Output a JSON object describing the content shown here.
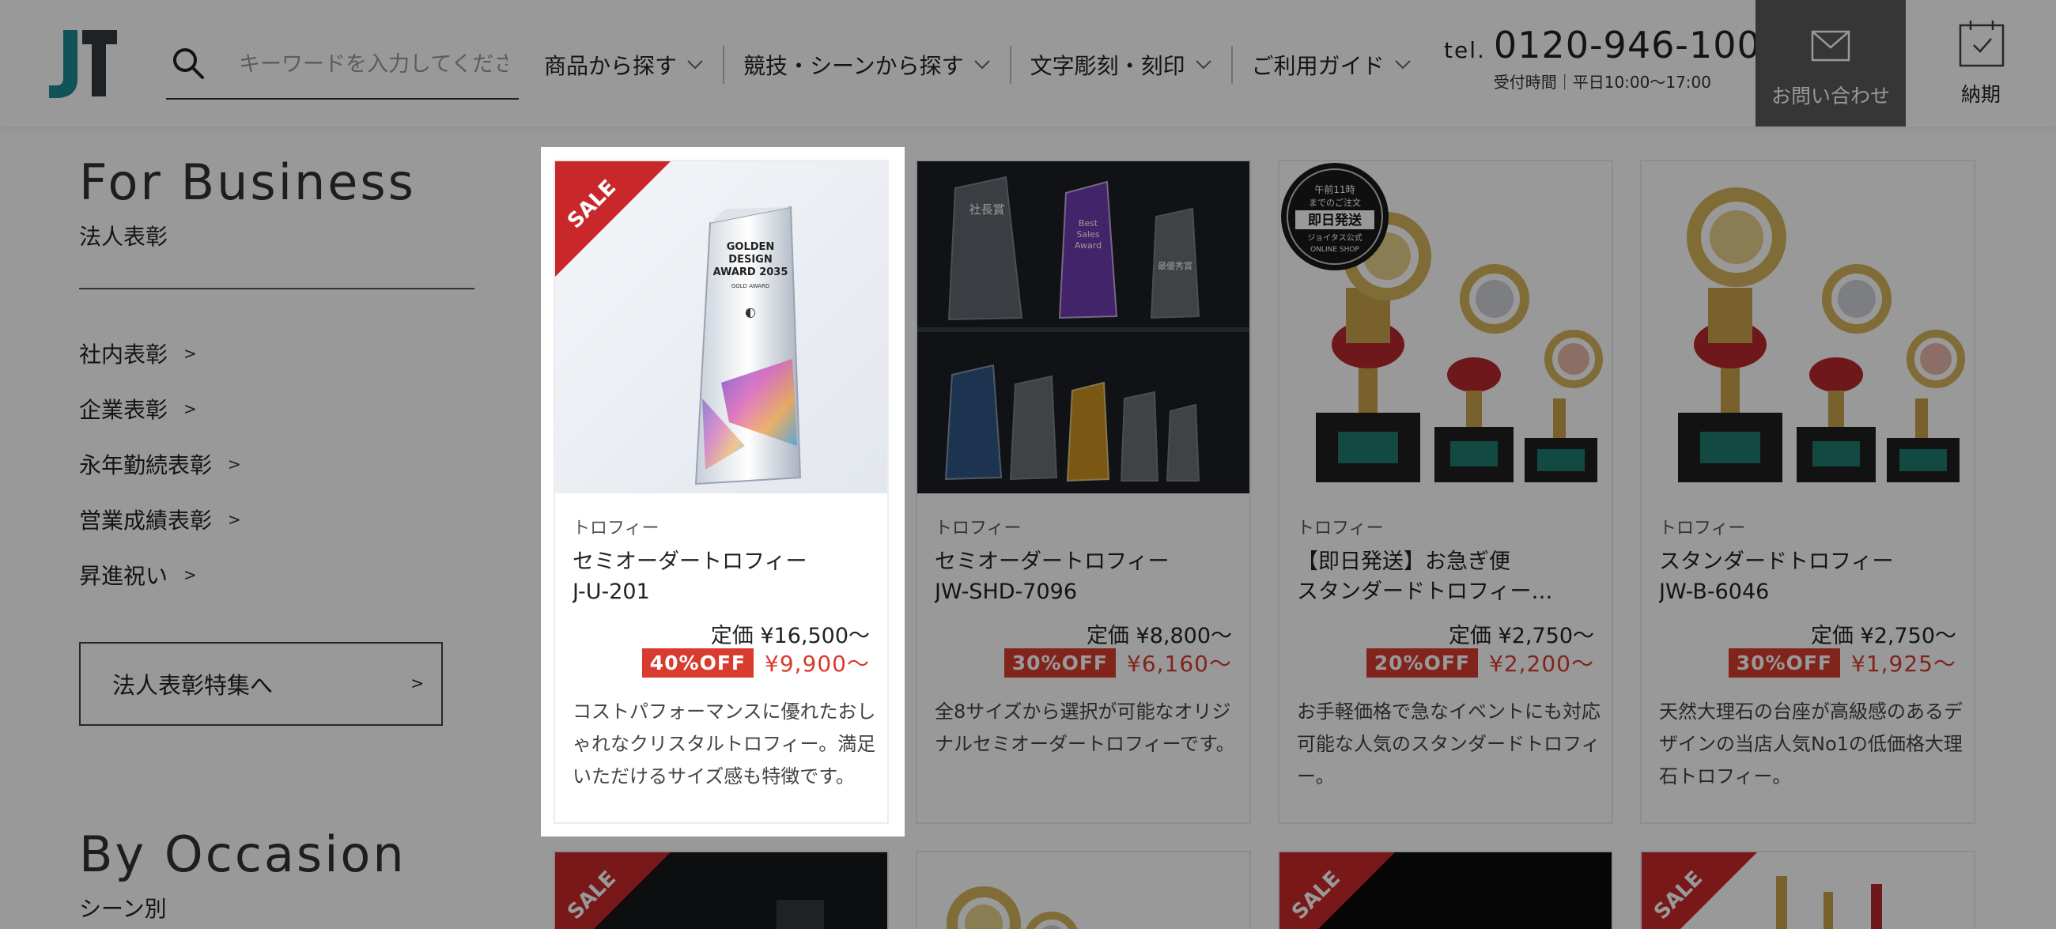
{
  "header": {
    "search_placeholder": "キーワードを入力してください",
    "nav": [
      "商品から探す",
      "競技・シーンから探す",
      "文字彫刻・刻印",
      "ご利用ガイド"
    ],
    "tel_prefix": "tel.",
    "tel_number": "0120-946-100",
    "hours": "受付時間｜平日10:00〜17:00",
    "contact_label": "お問い合わせ",
    "delivery_label": "納期"
  },
  "sidebar": {
    "business_title": "For Business",
    "business_sub": "法人表彰",
    "items": [
      "社内表彰",
      "企業表彰",
      "永年勤続表彰",
      "営業成績表彰",
      "昇進祝い"
    ],
    "arrow": ">",
    "feature_button": "法人表彰特集へ",
    "occasion_title": "By Occasion",
    "occasion_sub": "シーン別"
  },
  "products": [
    {
      "category": "トロフィー",
      "name_line1": "セミオーダートロフィー",
      "name_line2": "J-U-201",
      "list_price": "定価 ¥16,500〜",
      "discount": "40%OFF",
      "sale_price": "¥9,900〜",
      "description": "コストパフォーマンスに優れたおしゃれなクリスタルトロフィー。満足いただけるサイズ感も特徴です。",
      "sale_ribbon": "SALE",
      "award_text": [
        "GOLDEN",
        "DESIGN",
        "AWARD 2035",
        "GOLD AWARD"
      ]
    },
    {
      "category": "トロフィー",
      "name_line1": "セミオーダートロフィー",
      "name_line2": "JW-SHD-7096",
      "list_price": "定価 ¥8,800〜",
      "discount": "30%OFF",
      "sale_price": "¥6,160〜",
      "description": "全8サイズから選択が可能なオリジナルセミオーダートロフィーです。",
      "award_text": [
        "社長賞",
        "Best",
        "Sales",
        "Award",
        "最優秀賞"
      ]
    },
    {
      "category": "トロフィー",
      "name_line1": "【即日発送】お急ぎ便",
      "name_line2": "スタンダードトロフィー…",
      "list_price": "定価 ¥2,750〜",
      "discount": "20%OFF",
      "sale_price": "¥2,200〜",
      "description": "お手軽価格で急なイベントにも対応可能な人気のスタンダードトロフィー。",
      "stamp_lines": [
        "午前11時",
        "までのご注文",
        "即日発送",
        "ジョイタス公式",
        "ONLINE SHOP"
      ]
    },
    {
      "category": "トロフィー",
      "name_line1": "スタンダードトロフィー",
      "name_line2": "JW-B-6046",
      "list_price": "定価 ¥2,750〜",
      "discount": "30%OFF",
      "sale_price": "¥1,925〜",
      "description": "天然大理石の台座が高級感のあるデザインの当店人気No1の低価格大理石トロフィー。"
    }
  ],
  "row2_ribbon": "SALE",
  "colors": {
    "accent_red": "#d83c2f",
    "logo_teal": "#1b8a95",
    "logo_dark": "#33393f"
  }
}
